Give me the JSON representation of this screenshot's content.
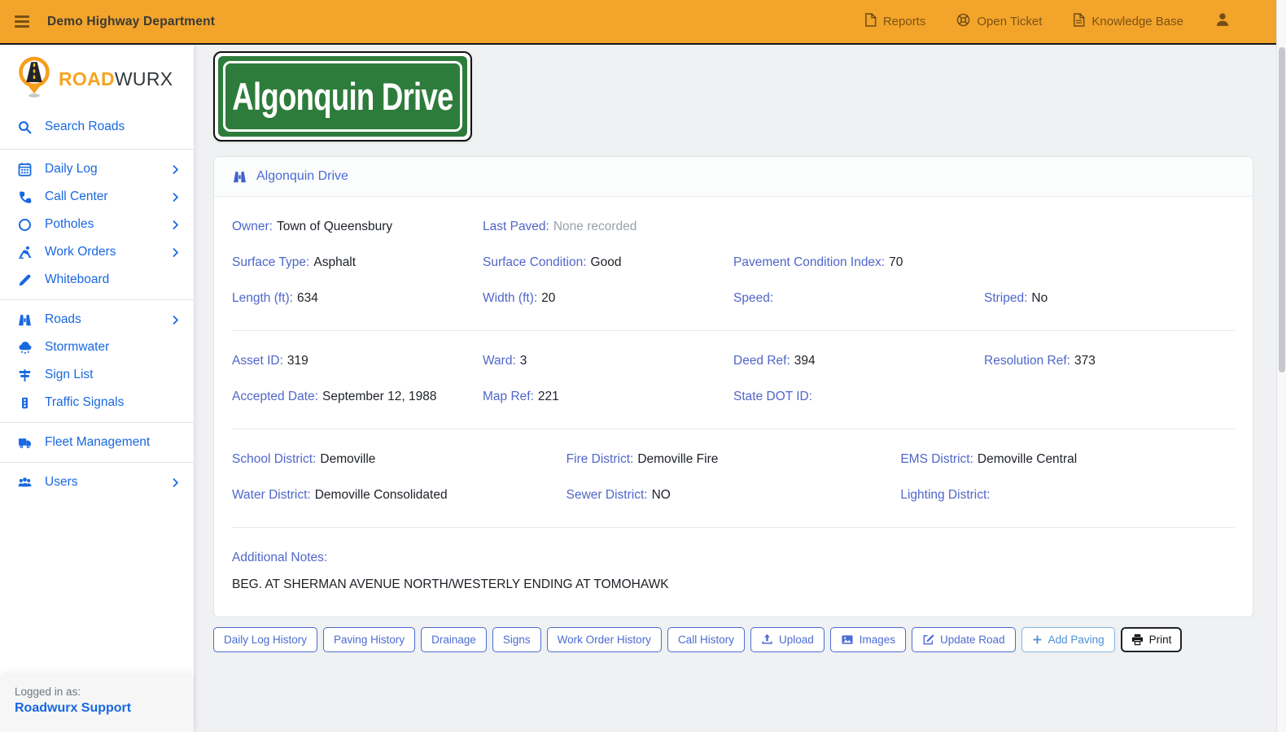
{
  "colors": {
    "topbar_orange": "#F3A42B",
    "sidebar_link_blue": "#1868E0",
    "field_label_blue": "#5066C9",
    "sign_green": "#2E7C3B",
    "button_blue": "#4C6CD2",
    "logo_orange": "#F5A41F"
  },
  "topbar": {
    "title": "Demo Highway Department",
    "links": [
      {
        "label": "Reports",
        "icon": "file-icon"
      },
      {
        "label": "Open Ticket",
        "icon": "life-ring-icon"
      },
      {
        "label": "Knowledge Base",
        "icon": "file-text-icon"
      }
    ],
    "user_icon": "user-icon"
  },
  "sidebar": {
    "logo": {
      "road": "ROAD",
      "wurx": "WURX",
      "icon": "map-pin-road-icon"
    },
    "search": {
      "label": "Search Roads",
      "icon": "search-icon"
    },
    "nav": [
      {
        "label": "Daily Log",
        "icon": "calendar-icon",
        "chevron": true
      },
      {
        "label": "Call Center",
        "icon": "phone-icon",
        "chevron": true
      },
      {
        "label": "Potholes",
        "icon": "circle-icon",
        "chevron": true
      },
      {
        "label": "Work Orders",
        "icon": "person-digging-icon",
        "chevron": true
      },
      {
        "label": "Whiteboard",
        "icon": "pen-icon",
        "chevron": false
      },
      {
        "divider": true
      },
      {
        "label": "Roads",
        "icon": "binoculars-icon",
        "chevron": true
      },
      {
        "label": "Stormwater",
        "icon": "cloud-rain-icon",
        "chevron": false
      },
      {
        "label": "Sign List",
        "icon": "sign-post-icon",
        "chevron": false
      },
      {
        "label": "Traffic Signals",
        "icon": "traffic-light-icon",
        "chevron": false
      },
      {
        "divider": true
      },
      {
        "label": "Fleet Management",
        "icon": "truck-icon",
        "chevron": false
      },
      {
        "divider": true
      },
      {
        "label": "Users",
        "icon": "users-icon",
        "chevron": true
      }
    ],
    "footer": {
      "logged_in_as": "Logged in as:",
      "user": "Roadwurx Support"
    }
  },
  "main": {
    "street_sign": "Algonquin Drive",
    "card": {
      "header": "Algonquin Drive",
      "header_icon": "binoculars-icon",
      "sections": [
        {
          "cols": 4,
          "rows": [
            [
              {
                "label": "Owner:",
                "value": "Town of Queensbury"
              },
              {
                "label": "Last Paved:",
                "value": "None recorded",
                "muted": true
              }
            ],
            [
              {
                "label": "Surface Type:",
                "value": "Asphalt"
              },
              {
                "label": "Surface Condition:",
                "value": "Good"
              },
              {
                "label": "Pavement Condition Index:",
                "value": "70"
              }
            ],
            [
              {
                "label": "Length (ft):",
                "value": "634"
              },
              {
                "label": "Width (ft):",
                "value": "20"
              },
              {
                "label": "Speed:",
                "value": ""
              },
              {
                "label": "Striped:",
                "value": "No"
              }
            ]
          ]
        },
        {
          "cols": 4,
          "rows": [
            [
              {
                "label": "Asset ID:",
                "value": "319"
              },
              {
                "label": "Ward:",
                "value": "3"
              },
              {
                "label": "Deed Ref:",
                "value": "394"
              },
              {
                "label": "Resolution Ref:",
                "value": "373"
              }
            ],
            [
              {
                "label": "Accepted Date:",
                "value": "September 12, 1988"
              },
              {
                "label": "Map Ref:",
                "value": "221"
              },
              {
                "label": "State DOT ID:",
                "value": ""
              }
            ]
          ]
        },
        {
          "cols": 3,
          "rows": [
            [
              {
                "label": "School District:",
                "value": "Demoville"
              },
              {
                "label": "Fire District:",
                "value": "Demoville Fire"
              },
              {
                "label": "EMS District:",
                "value": "Demoville Central"
              }
            ],
            [
              {
                "label": "Water District:",
                "value": "Demoville Consolidated"
              },
              {
                "label": "Sewer District:",
                "value": "NO"
              },
              {
                "label": "Lighting District:",
                "value": ""
              }
            ]
          ]
        }
      ],
      "notes_label": "Additional Notes:",
      "notes": "BEG. AT SHERMAN AVENUE NORTH/WESTERLY ENDING AT TOMOHAWK"
    },
    "actions": [
      {
        "label": "Daily Log History"
      },
      {
        "label": "Paving History"
      },
      {
        "label": "Drainage"
      },
      {
        "label": "Signs"
      },
      {
        "label": "Work Order History"
      },
      {
        "label": "Call History"
      },
      {
        "label": "Upload",
        "icon": "upload-icon"
      },
      {
        "label": "Images",
        "icon": "image-icon"
      },
      {
        "label": "Update Road",
        "icon": "edit-icon"
      },
      {
        "label": "Add Paving",
        "icon": "plus-icon",
        "style": "light"
      },
      {
        "label": "Print",
        "icon": "print-icon",
        "style": "dark"
      }
    ]
  }
}
